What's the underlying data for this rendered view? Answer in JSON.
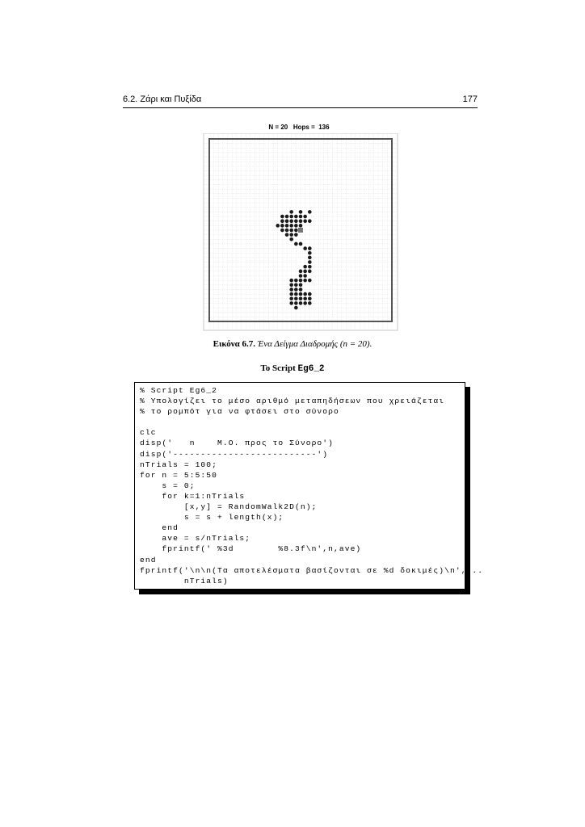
{
  "header": {
    "section": "6.2.  Ζάρι και Πυξίδα",
    "page_number": "177"
  },
  "figure": {
    "plot_title": "N = 20   Hops =  136",
    "grid_n": 20,
    "hops": 136,
    "caption_label": "Εικόνα 6.7.",
    "caption_text": " Ένα Δείγμα Διαδρομής (n = 20)."
  },
  "script": {
    "title_prefix": "Το Script ",
    "title_name": "Eg6_2",
    "code": "% Script Eg6_2\n% Υπολογίζει το μέσο αριθμό μεταπηδήσεων που χρειάζεται\n% το ρομπότ για να φτάσει στο σύνορο\n\nclc\ndisp('   n    Μ.Ο. προς το Σύνορο')\ndisp('--------------------------')\nnTrials = 100;\nfor n = 5:5:50\n    s = 0;\n    for k=1:nTrials\n        [x,y] = RandomWalk2D(n);\n        s = s + length(x);\n    end\n    ave = s/nTrials;\n    fprintf(' %3d        %8.3f\\n',n,ave)\nend\nfprintf('\\n\\n(Τα αποτελέσματα βασίζονται σε %d δοκιμές)\\n',...\n        nTrials)"
  },
  "walk": {
    "dot_color": "#1a1a1a",
    "marker_color": "#777777",
    "marker_cell": [
      0,
      0
    ],
    "cells": [
      [
        -2,
        4
      ],
      [
        0,
        4
      ],
      [
        2,
        4
      ],
      [
        -4,
        3
      ],
      [
        -3,
        3
      ],
      [
        -2,
        3
      ],
      [
        -1,
        3
      ],
      [
        0,
        3
      ],
      [
        1,
        3
      ],
      [
        -4,
        2
      ],
      [
        -3,
        2
      ],
      [
        -2,
        2
      ],
      [
        -1,
        2
      ],
      [
        0,
        2
      ],
      [
        1,
        2
      ],
      [
        2,
        2
      ],
      [
        -5,
        1
      ],
      [
        -4,
        1
      ],
      [
        -3,
        1
      ],
      [
        -2,
        1
      ],
      [
        -1,
        1
      ],
      [
        0,
        1
      ],
      [
        -4,
        0
      ],
      [
        -3,
        0
      ],
      [
        -2,
        0
      ],
      [
        -1,
        0
      ],
      [
        -3,
        -1
      ],
      [
        -2,
        -1
      ],
      [
        -1,
        -1
      ],
      [
        -2,
        -2
      ],
      [
        -1,
        -3
      ],
      [
        0,
        -3
      ],
      [
        1,
        -4
      ],
      [
        2,
        -4
      ],
      [
        2,
        -5
      ],
      [
        2,
        -6
      ],
      [
        2,
        -7
      ],
      [
        1,
        -8
      ],
      [
        2,
        -8
      ],
      [
        0,
        -9
      ],
      [
        1,
        -9
      ],
      [
        2,
        -9
      ],
      [
        0,
        -10
      ],
      [
        1,
        -10
      ],
      [
        -2,
        -11
      ],
      [
        -1,
        -11
      ],
      [
        0,
        -11
      ],
      [
        1,
        -11
      ],
      [
        2,
        -11
      ],
      [
        -2,
        -12
      ],
      [
        -1,
        -12
      ],
      [
        0,
        -12
      ],
      [
        -2,
        -13
      ],
      [
        -1,
        -13
      ],
      [
        0,
        -13
      ],
      [
        -2,
        -14
      ],
      [
        -1,
        -14
      ],
      [
        0,
        -14
      ],
      [
        1,
        -14
      ],
      [
        2,
        -14
      ],
      [
        -2,
        -15
      ],
      [
        -1,
        -15
      ],
      [
        0,
        -15
      ],
      [
        1,
        -15
      ],
      [
        2,
        -15
      ],
      [
        -2,
        -16
      ],
      [
        -1,
        -16
      ],
      [
        0,
        -16
      ],
      [
        1,
        -16
      ],
      [
        2,
        -16
      ],
      [
        -1,
        -17
      ]
    ]
  }
}
